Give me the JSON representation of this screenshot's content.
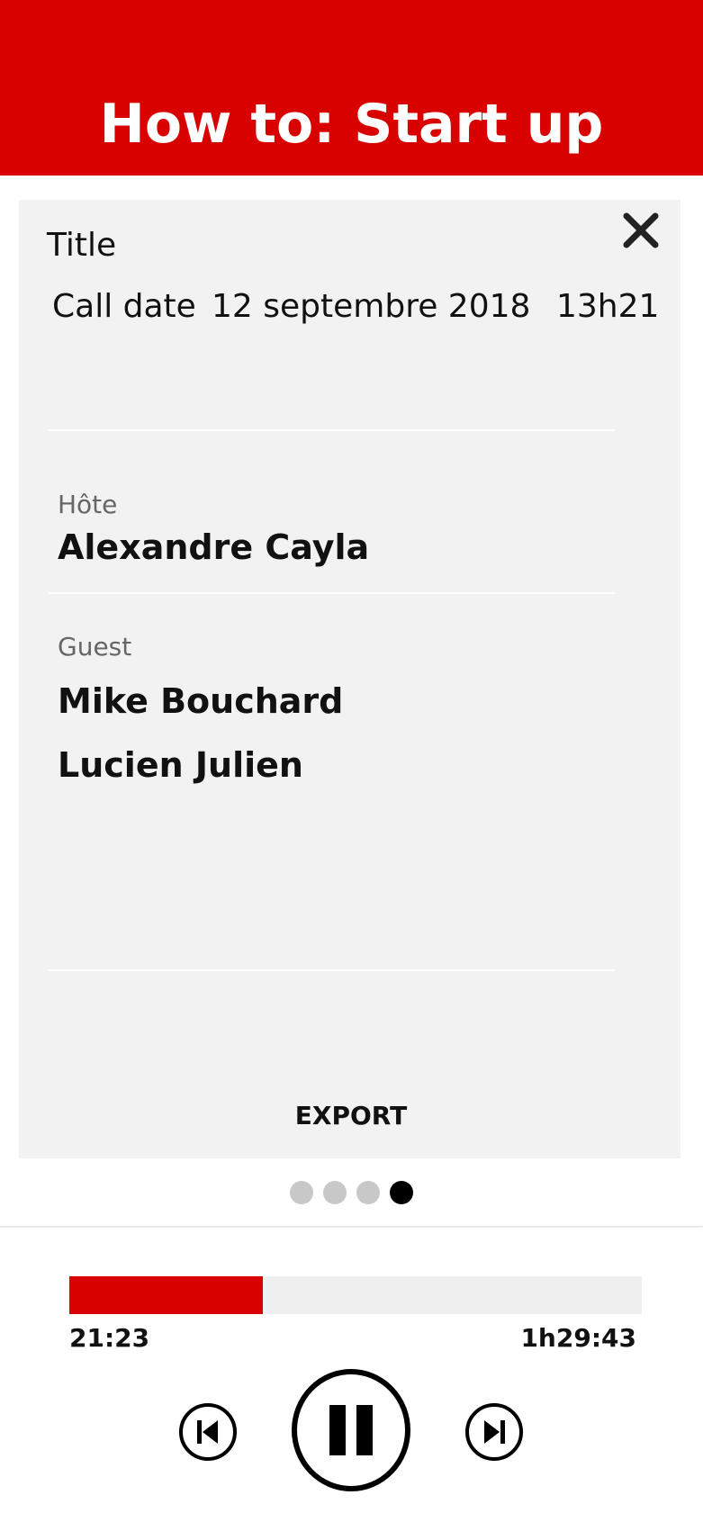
{
  "header": {
    "title": "How to: Start up"
  },
  "card": {
    "title_label": "Title",
    "call_label": "Call date",
    "call_date": "12 septembre 2018",
    "call_time": "13h21",
    "host_label": "Hôte",
    "host_name": "Alexandre Cayla",
    "guest_label": "Guest",
    "guests": [
      "Mike Bouchard",
      "Lucien Julien"
    ],
    "export_label": "EXPORT"
  },
  "pager": {
    "count": 4,
    "active_index": 3
  },
  "player": {
    "elapsed": "21:23",
    "total": "1h29:43",
    "progress_fraction": 0.338,
    "accent_color": "#d90000"
  },
  "icons": {
    "close": "close-icon",
    "previous": "skip-previous-icon",
    "pause": "pause-icon",
    "next": "skip-next-icon"
  }
}
